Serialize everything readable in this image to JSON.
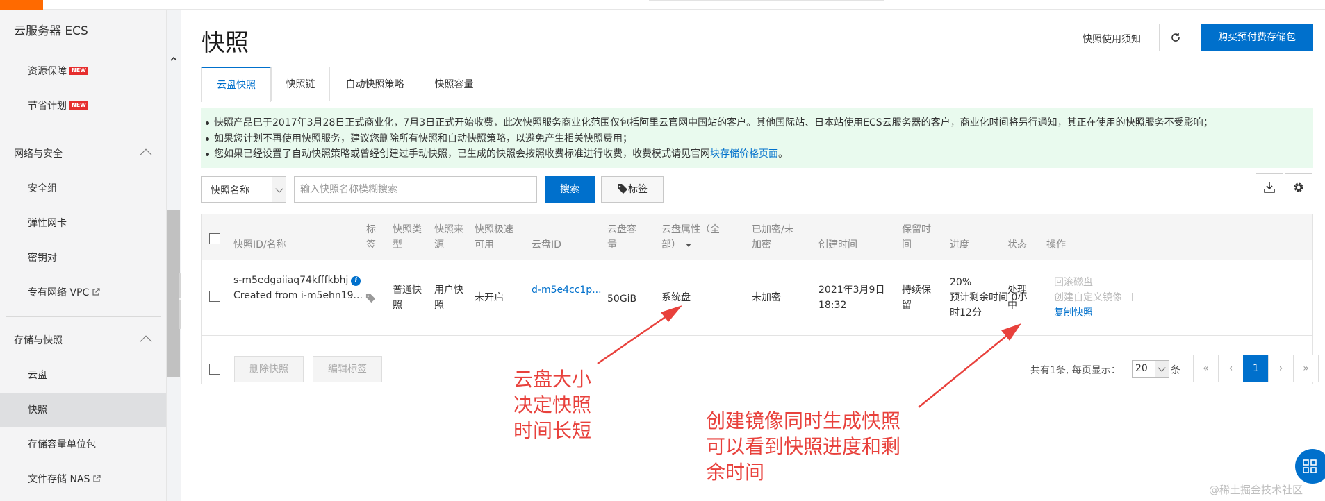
{
  "sidebar": {
    "title": "云服务器 ECS",
    "top_items": [
      {
        "label": "资源保障",
        "badge": "NEW"
      },
      {
        "label": "节省计划",
        "badge": "NEW"
      }
    ],
    "sections": [
      {
        "label": "网络与安全",
        "items": [
          "安全组",
          "弹性网卡",
          "密钥对",
          "专有网络 VPC"
        ]
      },
      {
        "label": "存储与快照",
        "items": [
          "云盘",
          "快照",
          "存储容量单位包",
          "文件存储 NAS"
        ]
      }
    ],
    "active_item": "快照"
  },
  "header": {
    "title": "快照",
    "notice_link": "快照使用须知",
    "buy_button": "购买预付费存储包"
  },
  "tabs": [
    "云盘快照",
    "快照链",
    "自动快照策略",
    "快照容量"
  ],
  "banner": {
    "line1": "快照产品已于2017年3月28日正式商业化，7月3日正式开始收费，此次快照服务商业化范围仅包括阿里云官网中国站的客户。其他国际站、日本站使用ECS云服务器的客户，商业化时间将另行通知，其正在使用的快照服务不受影响；",
    "line2": "如果您计划不再使用快照服务，建议您删除所有快照和自动快照策略，以避免产生相关快照费用；",
    "line3_prefix": "您如果已经设置了自动快照策略或曾经创建过手动快照，已生成的快照会按照收费标准进行收费，收费模式请见官网",
    "line3_link": "块存储价格页面",
    "line3_suffix": "。"
  },
  "filter": {
    "select_value": "快照名称",
    "search_placeholder": "输入快照名称模糊搜索",
    "search_button": "搜索",
    "tag_button": "标签"
  },
  "table": {
    "headers": {
      "id_name": "快照ID/名称",
      "tag": [
        "标",
        "签"
      ],
      "type": [
        "快照类",
        "型"
      ],
      "source": [
        "快照来",
        "源"
      ],
      "fast": [
        "快照极速",
        "可用"
      ],
      "disk_id": "云盘ID",
      "capacity": [
        "云盘容",
        "量"
      ],
      "attr": [
        "云盘属性（全",
        "部）"
      ],
      "encrypted": [
        "已加密/未",
        "加密"
      ],
      "created": "创建时间",
      "retention": [
        "保留时",
        "间"
      ],
      "progress": "进度",
      "status": "状态",
      "actions": "操作"
    },
    "row": {
      "id": "s-m5edgaiiaq74kfffkbhj",
      "name": "Created from i-m5ehn19...",
      "type": [
        "普通快",
        "照"
      ],
      "source": [
        "用户快",
        "照"
      ],
      "fast": "未开启",
      "disk_id": "d-m5e4cc1p...",
      "capacity": "50GiB",
      "attr": "系统盘",
      "encrypted": "未加密",
      "created": [
        "2021年3月9日",
        "18:32"
      ],
      "retention": [
        "持续保",
        "留"
      ],
      "progress_value": "20%",
      "remaining": [
        "预计剩余时间 0小",
        "时12分"
      ],
      "status": [
        "处理",
        "中"
      ],
      "actions": [
        "回滚磁盘",
        "创建自定义镜像",
        "复制快照"
      ]
    },
    "footer": {
      "delete_button": "删除快照",
      "edit_tags_button": "编辑标签",
      "total_text": "共有1条, 每页显示：",
      "page_size": "20",
      "page_size_unit": "条",
      "pages": [
        "«",
        "‹",
        "1",
        "›",
        "»"
      ]
    }
  },
  "annotations": {
    "disk_size": [
      "云盘大小",
      "决定快照",
      "时间长短"
    ],
    "progress": [
      "创建镜像同时生成快照",
      "可以看到快照进度和剩",
      "余时间"
    ]
  },
  "watermark": "@稀土掘金技术社区",
  "colors": {
    "accent": "#0070cc",
    "annotation": "#e8413c",
    "banner_bg": "#e9faee",
    "brand": "#ff6a00"
  }
}
